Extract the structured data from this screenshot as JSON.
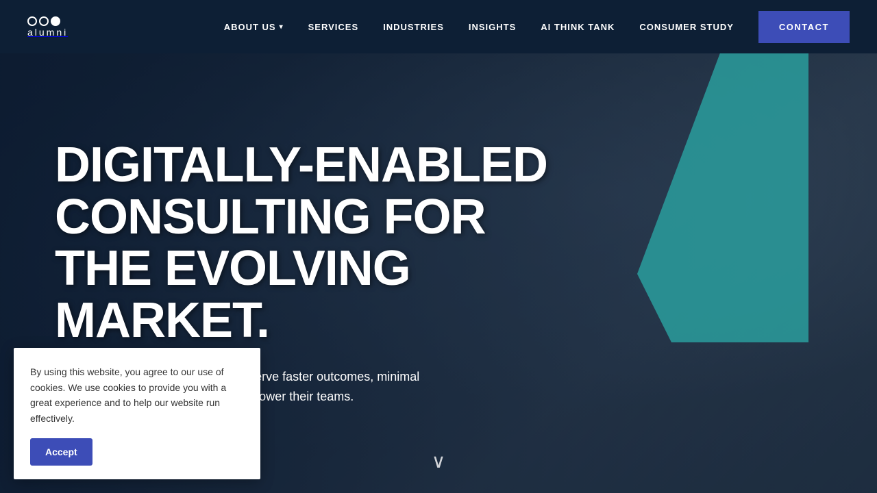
{
  "site": {
    "logo_circles": [
      "empty",
      "empty",
      "filled"
    ],
    "logo_top": "ooo",
    "logo_name": "alumni"
  },
  "navbar": {
    "links": [
      {
        "label": "ABOUT US",
        "has_dropdown": true,
        "id": "about-us"
      },
      {
        "label": "SERVICES",
        "has_dropdown": false,
        "id": "services"
      },
      {
        "label": "INDUSTRIES",
        "has_dropdown": false,
        "id": "industries"
      },
      {
        "label": "INSIGHTS",
        "has_dropdown": false,
        "id": "insights"
      },
      {
        "label": "AI THINK TANK",
        "has_dropdown": false,
        "id": "ai-think-tank"
      },
      {
        "label": "CONSUMER STUDY",
        "has_dropdown": false,
        "id": "consumer-study"
      }
    ],
    "cta_label": "CONTACT"
  },
  "hero": {
    "title": "DIGITALLY-ENABLED CONSULTING FOR THE EVOLVING MARKET.",
    "subtitle": "Our digital transformation clients deserve faster outcomes, minimal disruption, and robust support to empower their teams.",
    "scroll_icon": "∨"
  },
  "cookie": {
    "text": "By using this website, you agree to our use of cookies. We use cookies to provide you with a great experience and to help our website run effectively.",
    "accept_label": "Accept"
  },
  "colors": {
    "nav_bg": "#0d1f35",
    "cta_bg": "#3d4db7",
    "teal_accent": "#2a9d9d",
    "white": "#ffffff"
  }
}
